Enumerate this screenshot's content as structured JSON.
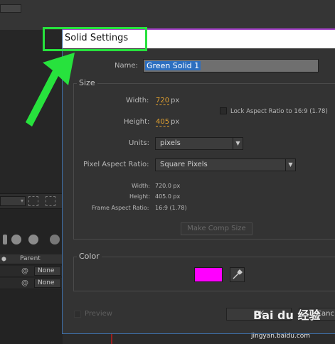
{
  "dialog": {
    "title": "Solid Settings",
    "name_label": "Name:",
    "name_value": "Green Solid 1"
  },
  "size": {
    "section_title": "Size",
    "width_label": "Width:",
    "width_value": "720",
    "height_label": "Height:",
    "height_value": "405",
    "unit_px": "px",
    "lock_label": "Lock Aspect Ratio to 16:9 (1.78)",
    "units_label": "Units:",
    "units_value": "pixels",
    "par_label": "Pixel Aspect Ratio:",
    "par_value": "Square Pixels",
    "info_width_label": "Width:",
    "info_width_value": "720.0 px",
    "info_height_label": "Height:",
    "info_height_value": "405.0 px",
    "info_far_label": "Frame Aspect Ratio:",
    "info_far_value": "16:9 (1.78)",
    "make_comp_size": "Make Comp Size"
  },
  "color": {
    "section_title": "Color",
    "swatch": "#ff00ff"
  },
  "footer": {
    "preview_label": "Preview",
    "ok_label": "OK",
    "cancel_label": "Canc"
  },
  "background_panel": {
    "parent_header": "Parent",
    "rows": [
      {
        "parent": "None"
      },
      {
        "parent": "None"
      }
    ]
  },
  "annotation": {
    "highlight_color": "#27e23d"
  },
  "watermark": {
    "logo_text": "Bai du 经验",
    "url": "jingyan.baidu.com"
  },
  "icons": [
    "eyedropper-icon",
    "dropdown-arrow-icon",
    "annotation-arrow-icon",
    "spiral-icon"
  ]
}
